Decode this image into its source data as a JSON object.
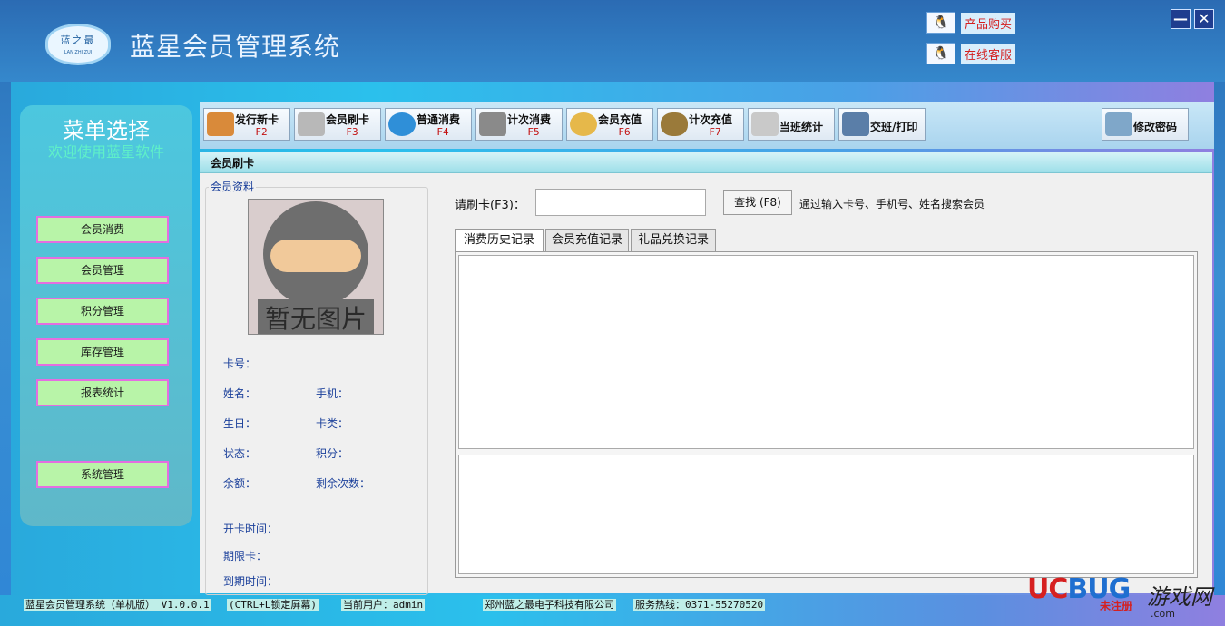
{
  "app": {
    "logo_text": "蓝之最",
    "logo_sub": "LAN ZHI ZUI",
    "title": "蓝星会员管理系统"
  },
  "top_links": [
    {
      "label": "产品购买",
      "icon": "qq-penguin-icon"
    },
    {
      "label": "在线客服",
      "icon": "qq-penguin-icon"
    }
  ],
  "window_controls": {
    "minimize": "—",
    "close": "✕"
  },
  "sidebar": {
    "title": "菜单选择",
    "subtitle": "欢迎使用蓝星软件",
    "items": [
      "会员消费",
      "会员管理",
      "积分管理",
      "库存管理",
      "报表统计",
      "系统管理"
    ]
  },
  "toolbar": {
    "buttons": [
      {
        "label": "发行新卡",
        "key": "F2",
        "icon": "card-stack-icon",
        "color": "#d98a3a"
      },
      {
        "label": "会员刷卡",
        "key": "F3",
        "icon": "credit-card-icon",
        "color": "#b8b8b8"
      },
      {
        "label": "普通消费",
        "key": "F4",
        "icon": "buy-now-icon",
        "color": "#2f8fd8"
      },
      {
        "label": "计次消费",
        "key": "F5",
        "icon": "checklist-icon",
        "color": "#8a8a8a"
      },
      {
        "label": "会员充值",
        "key": "F6",
        "icon": "piggy-bank-icon",
        "color": "#e6b84a"
      },
      {
        "label": "计次充值",
        "key": "F7",
        "icon": "money-bag-icon",
        "color": "#9a7a3a"
      },
      {
        "label": "当班统计",
        "key": "",
        "icon": "document-icon",
        "color": "#c9c9c9"
      },
      {
        "label": "交班/打印",
        "key": "",
        "icon": "printer-icon",
        "color": "#5a7ea8"
      }
    ],
    "change_password": {
      "label": "修改密码",
      "icon": "keys-icon"
    }
  },
  "panel": {
    "title": "会员刷卡",
    "info_legend": "会员资料",
    "photo_caption": "暂无图片",
    "fields": {
      "card_no": "卡号：",
      "name": "姓名：",
      "phone": "手机：",
      "birthday": "生日：",
      "card_type": "卡类：",
      "status": "状态：",
      "points": "积分：",
      "balance": "余额：",
      "remaining": "剩余次数：",
      "open_time": "开卡时间：",
      "period_card": "期限卡：",
      "expire_time": "到期时间："
    },
    "search": {
      "label": "请刷卡(F3)：",
      "value": "",
      "button": "查找 (F8)",
      "hint": "通过输入卡号、手机号、姓名搜索会员"
    },
    "tabs": [
      "消费历史记录",
      "会员充值记录",
      "礼品兑换记录"
    ]
  },
  "statusbar": {
    "app_version": "蓝星会员管理系统（单机版） V1.0.0.1",
    "lock_hint": "(CTRL+L锁定屏幕)",
    "current_user": "当前用户：admin",
    "company": "郑州蓝之最电子科技有限公司",
    "hotline": "服务热线：0371-55270520",
    "register": "未注册"
  },
  "watermark": {
    "brand_red": "UC",
    "brand_blue": "BUG",
    "cn": "游戏网",
    "url": ".com"
  }
}
